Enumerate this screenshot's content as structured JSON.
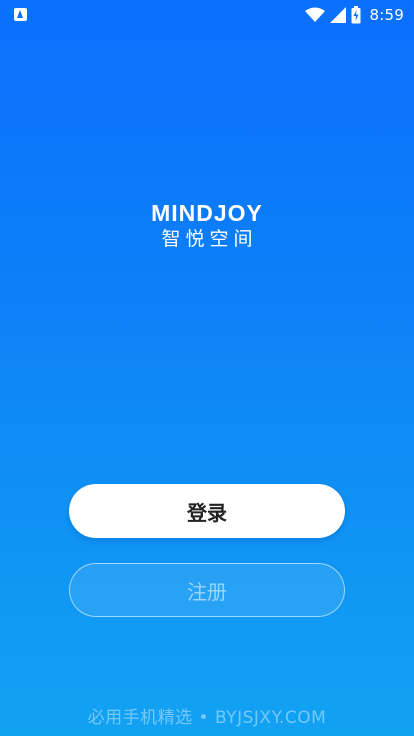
{
  "status_bar": {
    "time": "8:59",
    "icons": [
      "app-notification-icon",
      "wifi-icon",
      "signal-icon",
      "battery-icon"
    ]
  },
  "brand": {
    "name_en": "MINDJOY",
    "name_cn": "智悦空间"
  },
  "actions": {
    "login_label": "登录",
    "register_label": "注册"
  },
  "watermark": "必用手机精选 • BYJSJXY.COM",
  "colors": {
    "gradient_top": "#0a6ffd",
    "gradient_bottom": "#12a2f2",
    "login_bg": "#ffffff",
    "login_text": "#222222"
  }
}
